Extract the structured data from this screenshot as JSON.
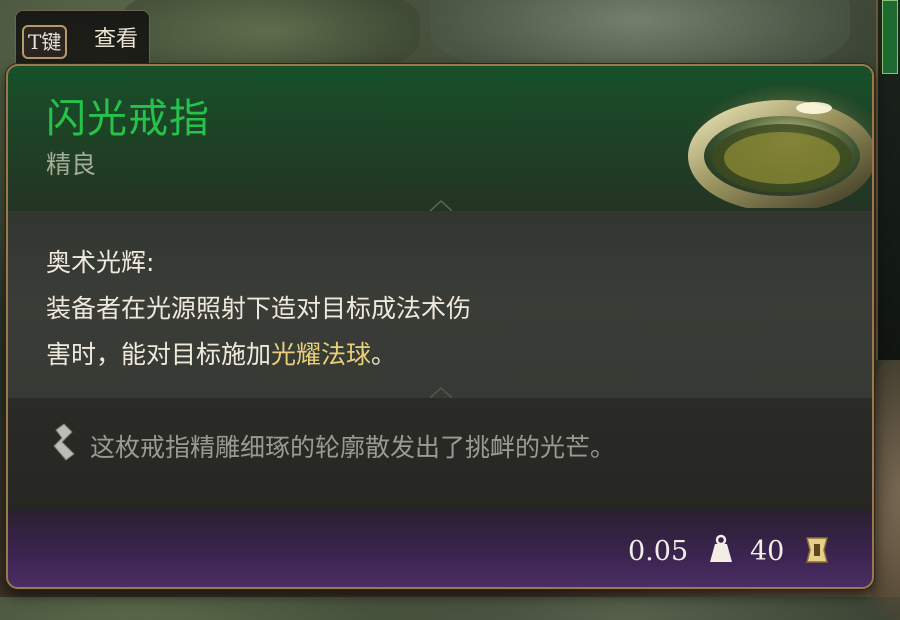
{
  "hint": {
    "key": "T键",
    "label": "查看"
  },
  "item": {
    "name": "闪光戒指",
    "rarity": "精良",
    "ability_title": "奥术光辉:",
    "desc_line1": "装备者在光源照射下造对目标成法术伤",
    "desc_line2_pre": "害时，能对目标施加",
    "desc_line2_highlight": "光耀法球",
    "desc_line2_post": "。",
    "flavor": "这枚戒指精雕细琢的轮廓散发出了挑衅的光芒。"
  },
  "footer": {
    "weight": "0.05",
    "price": "40"
  },
  "colors": {
    "name": "#27c24a",
    "rarity": "#a5ab95",
    "highlight": "#e8cf7a",
    "border": "#9a7a4c"
  },
  "icons": {
    "ring": "ring-icon",
    "flavor": "quill-icon",
    "weight": "weight-icon",
    "price": "gold-coin-icon"
  }
}
